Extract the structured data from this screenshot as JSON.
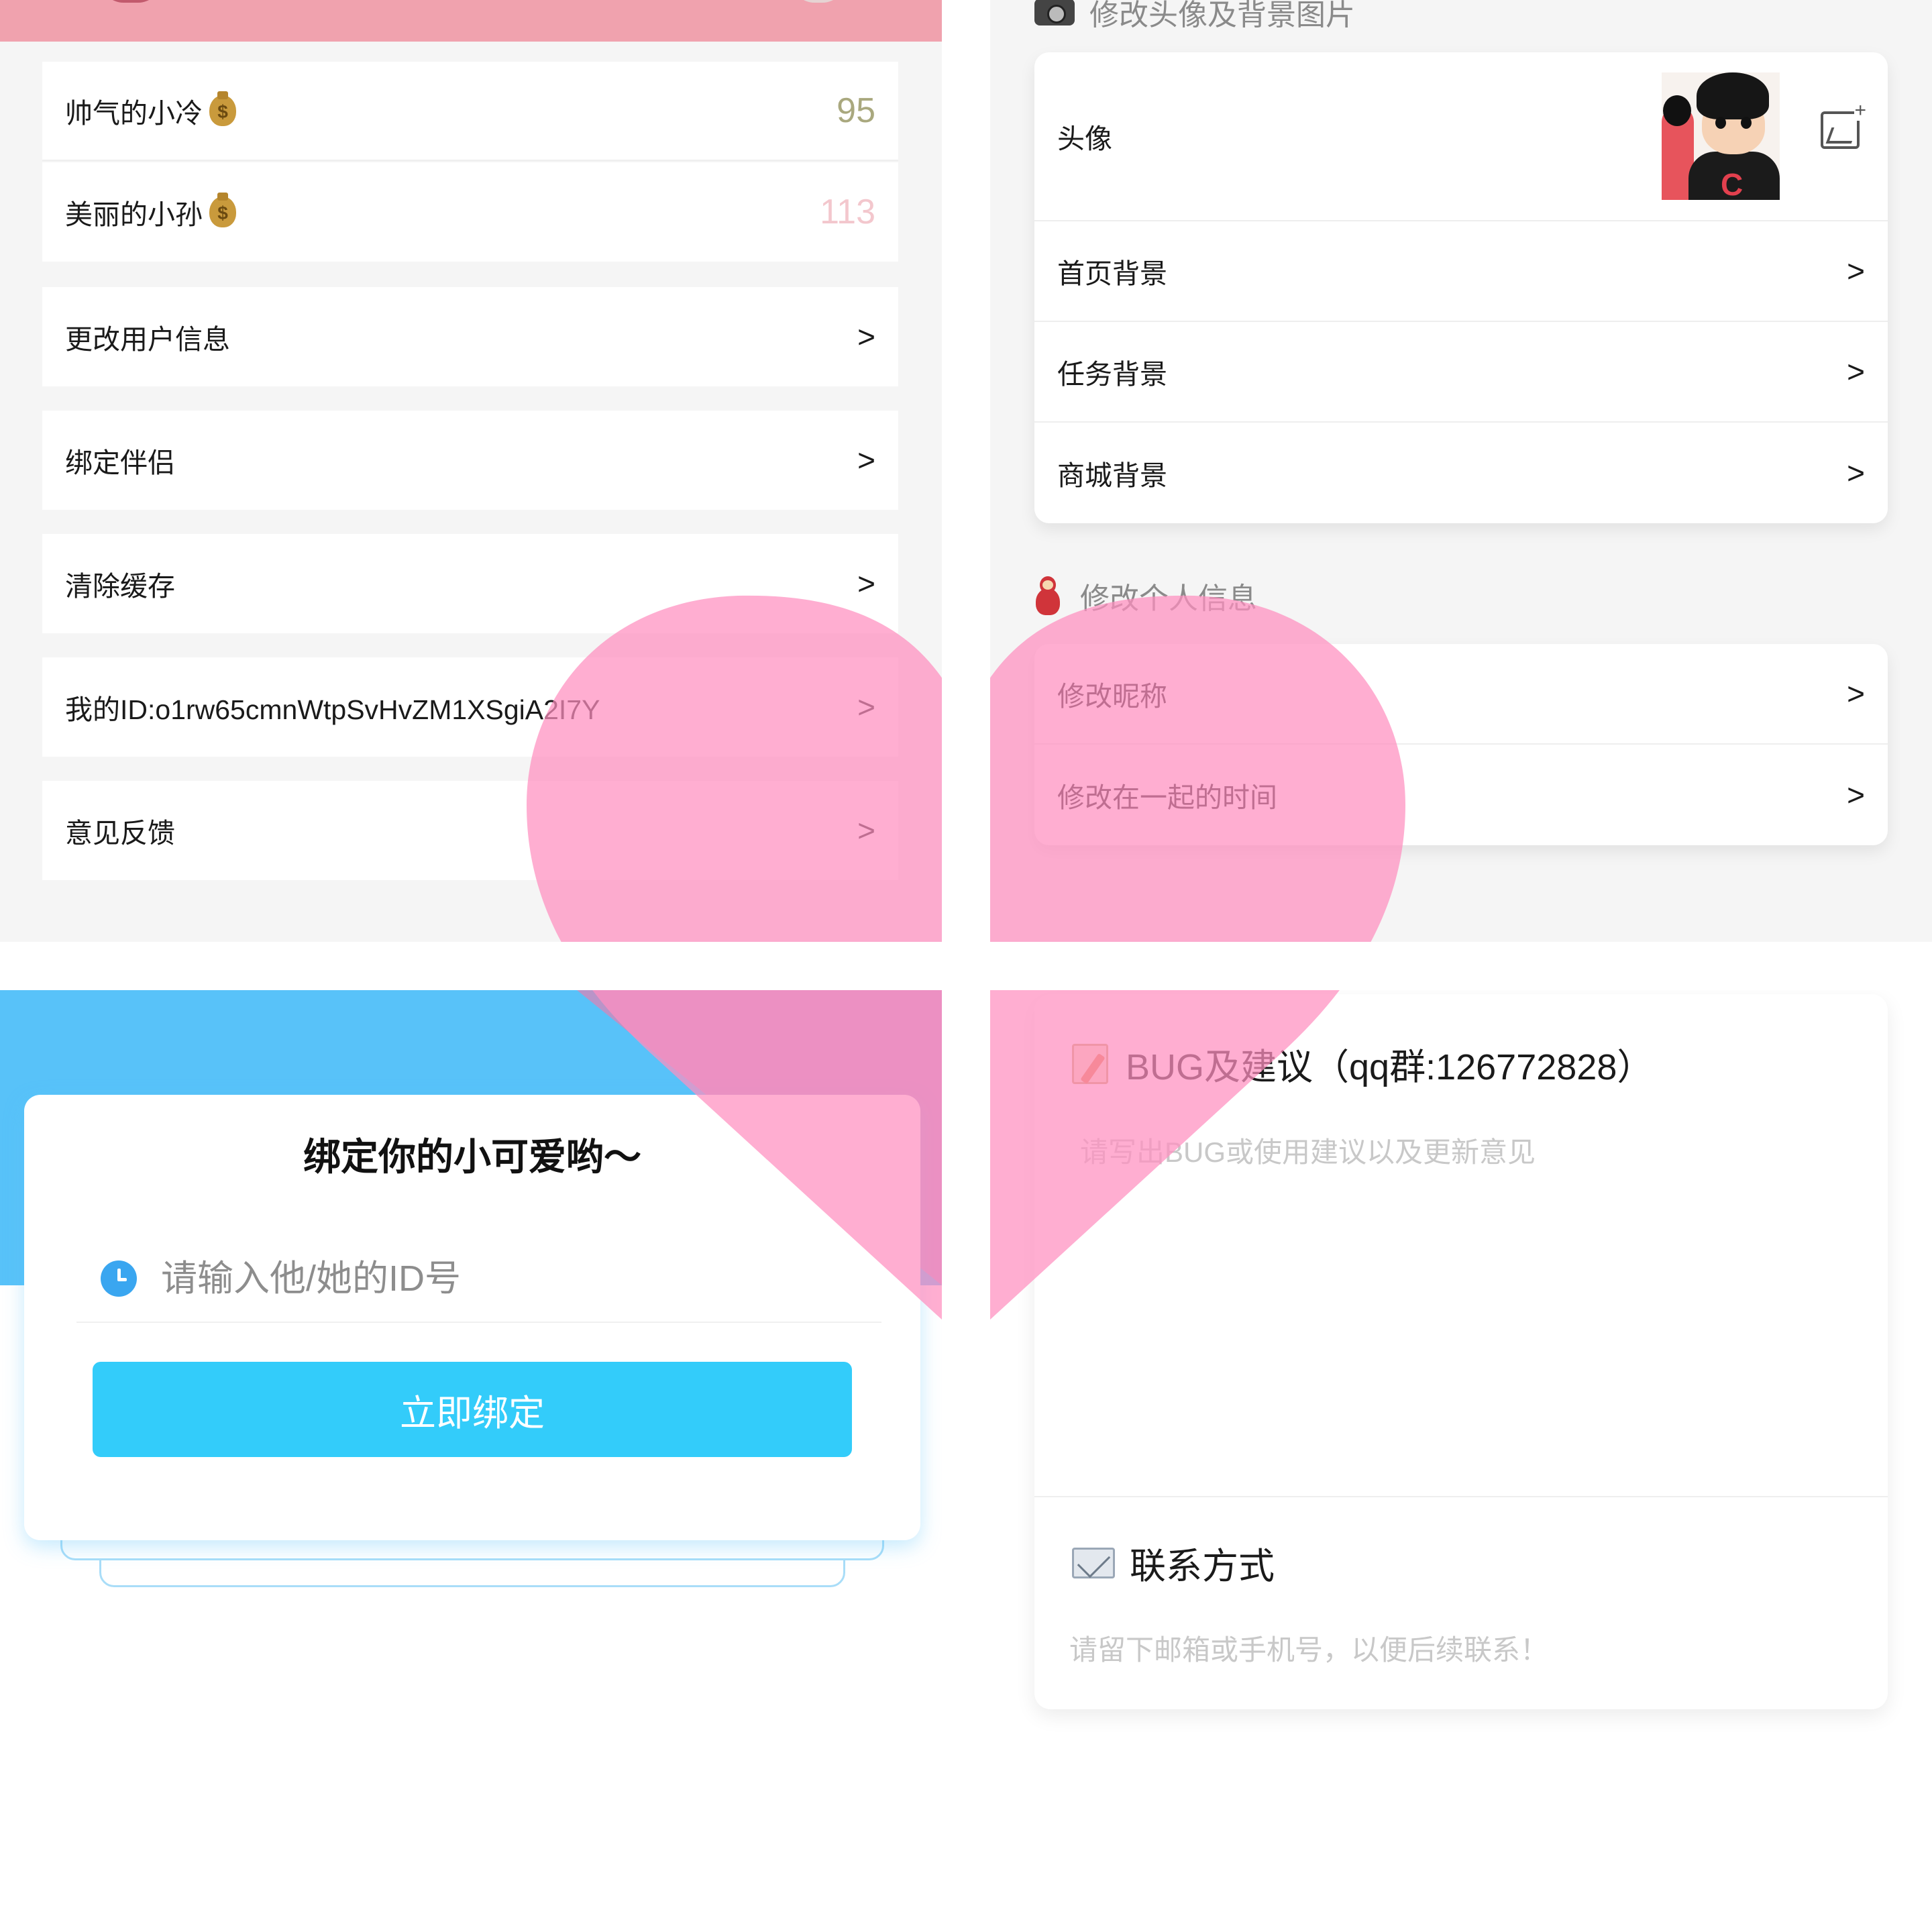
{
  "settings_list": {
    "couple": [
      {
        "name": "帅气的小冷",
        "score": "95",
        "score_color": "#a9a87e"
      },
      {
        "name": "美丽的小孙",
        "score": "113",
        "score_color": "#f3c7cd"
      }
    ],
    "items": [
      {
        "label": "更改用户信息",
        "chevron": ">"
      },
      {
        "label": "绑定伴侣",
        "chevron": ">"
      },
      {
        "label": "清除缓存",
        "chevron": ">"
      },
      {
        "label": "我的ID:o1rw65cmnWtpSvHvZM1XSgiA2I7Y",
        "chevron": ">"
      },
      {
        "label": "意见反馈",
        "chevron": ">"
      }
    ]
  },
  "profile_edit": {
    "images_section_title": "修改头像及背景图片",
    "avatar_label": "头像",
    "image_rows": [
      {
        "label": "首页背景",
        "chevron": ">"
      },
      {
        "label": "任务背景",
        "chevron": ">"
      },
      {
        "label": "商城背景",
        "chevron": ">"
      }
    ],
    "info_section_title": "修改个人信息",
    "info_rows": [
      {
        "label": "修改昵称",
        "chevron": ">"
      },
      {
        "label": "修改在一起的时间",
        "chevron": ">"
      }
    ]
  },
  "bind_partner": {
    "title": "绑定你的小可爱哟～",
    "id_placeholder": "请输入他/她的ID号",
    "bind_button": "立即绑定"
  },
  "feedback": {
    "bug_title": "BUG及建议（qq群:126772828）",
    "bug_placeholder": "请写出BUG或使用建议以及更新意见",
    "contact_title": "联系方式",
    "contact_placeholder": "请留下邮箱或手机号，以便后续联系！"
  },
  "colors": {
    "accent_pink": "#f0a2ae",
    "heart_pink": "#ff8fbf",
    "bind_blue": "#33ccfa",
    "header_blue": "#58c2f9"
  }
}
